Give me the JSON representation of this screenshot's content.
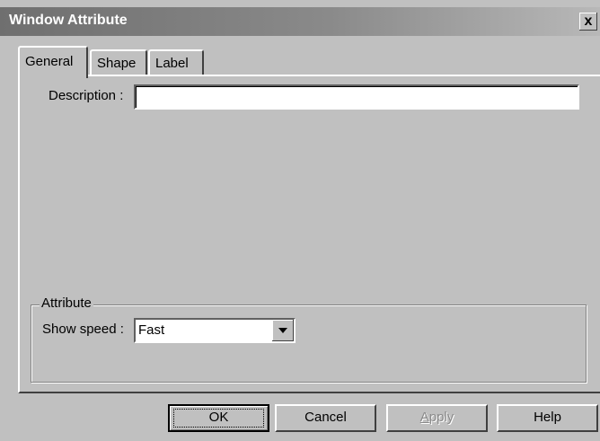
{
  "window": {
    "title": "Window Attribute",
    "close_label": "x"
  },
  "tabs": [
    {
      "label": "General",
      "active": true
    },
    {
      "label": "Shape",
      "active": false
    },
    {
      "label": "Label",
      "active": false
    }
  ],
  "general": {
    "description_label": "Description :",
    "description_value": "",
    "attribute_group_label": "Attribute",
    "show_speed_label": "Show speed :",
    "show_speed_value": "Fast"
  },
  "buttons": {
    "ok": "OK",
    "cancel": "Cancel",
    "apply": "Apply",
    "help": "Help"
  }
}
